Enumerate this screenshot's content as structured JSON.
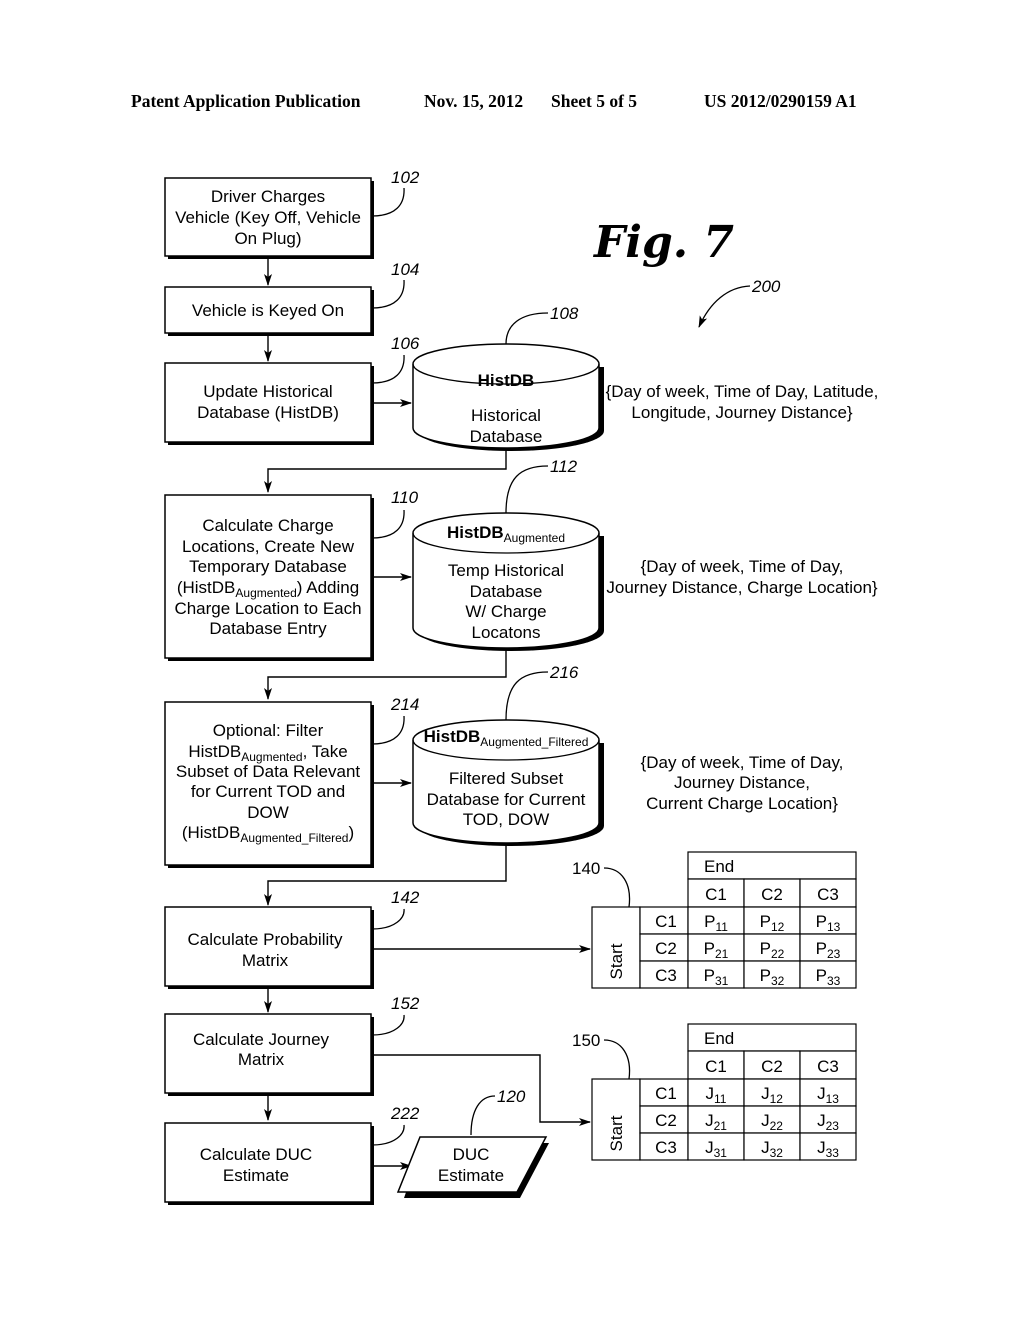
{
  "header": {
    "publication": "Patent Application Publication",
    "date": "Nov. 15, 2012",
    "sheet": "Sheet 5 of 5",
    "number": "US 2012/0290159 A1"
  },
  "figure": {
    "label": "Fig. 7",
    "ref": "200"
  },
  "steps": {
    "s102": {
      "ref": "102",
      "lines": [
        "Driver Charges",
        "Vehicle (Key Off, Vehicle",
        "On Plug)"
      ]
    },
    "s104": {
      "ref": "104",
      "lines": [
        "Vehicle is Keyed On"
      ]
    },
    "s106": {
      "ref": "106",
      "lines": [
        "Update Historical",
        "Database (HistDB)"
      ]
    },
    "s110": {
      "ref": "110",
      "l1": "Calculate Charge",
      "l2": "Locations, Create New",
      "l3": "Temporary Database",
      "l4a": "(HistDB",
      "l4sub": "Augmented",
      "l4b": ") Adding",
      "l5": "Charge Location to Each",
      "l6": "Database Entry"
    },
    "s214": {
      "ref": "214",
      "l1": "Optional: Filter",
      "l2a": "HistDB",
      "l2sub": "Augmented",
      "l2b": ", Take",
      "l3": "Subset of Data Relevant",
      "l4": "for Current TOD and",
      "l5": "DOW",
      "l6a": "(HistDB",
      "l6sub": "Augmented_Filtered",
      "l6b": ")"
    },
    "s142": {
      "ref": "142",
      "lines": [
        "Calculate Probability",
        "Matrix"
      ]
    },
    "s152": {
      "ref": "152",
      "lines": [
        "Calculate Journey",
        "Matrix"
      ]
    },
    "s222": {
      "ref": "222",
      "lines": [
        "Calculate DUC",
        "Estimate"
      ]
    }
  },
  "databases": {
    "d108": {
      "ref": "108",
      "title": "HistDB",
      "title_sub": "",
      "lines": [
        "Historical",
        "Database"
      ],
      "fields": [
        "{Day of week, Time of Day, Latitude,",
        "Longitude, Journey Distance}"
      ]
    },
    "d112": {
      "ref": "112",
      "title": "HistDB",
      "title_sub": "Augmented",
      "lines": [
        "Temp Historical",
        "Database",
        "W/ Charge",
        "Locatons"
      ],
      "fields": [
        "{Day of week, Time of Day,",
        "Journey Distance, Charge Location}"
      ]
    },
    "d216": {
      "ref": "216",
      "title": "HistDB",
      "title_sub": "Augmented_Filtered",
      "lines": [
        "Filtered Subset",
        "Database for Current",
        "TOD, DOW"
      ],
      "fields": [
        "{Day of week, Time of Day,",
        "Journey Distance,",
        "Current Charge Location}"
      ]
    }
  },
  "output": {
    "ref": "120",
    "lines": [
      "DUC",
      "Estimate"
    ]
  },
  "matrices": {
    "prob": {
      "ref": "140",
      "end_label": "End",
      "start_label": "Start",
      "cols": [
        "C1",
        "C2",
        "C3"
      ],
      "rows": [
        "C1",
        "C2",
        "C3"
      ],
      "letter": "P",
      "cells": [
        [
          "11",
          "12",
          "13"
        ],
        [
          "21",
          "22",
          "23"
        ],
        [
          "31",
          "32",
          "33"
        ]
      ]
    },
    "journey": {
      "ref": "150",
      "end_label": "End",
      "start_label": "Start",
      "cols": [
        "C1",
        "C2",
        "C3"
      ],
      "rows": [
        "C1",
        "C2",
        "C3"
      ],
      "letter": "J",
      "cells": [
        [
          "11",
          "12",
          "13"
        ],
        [
          "21",
          "22",
          "23"
        ],
        [
          "31",
          "32",
          "33"
        ]
      ]
    }
  }
}
